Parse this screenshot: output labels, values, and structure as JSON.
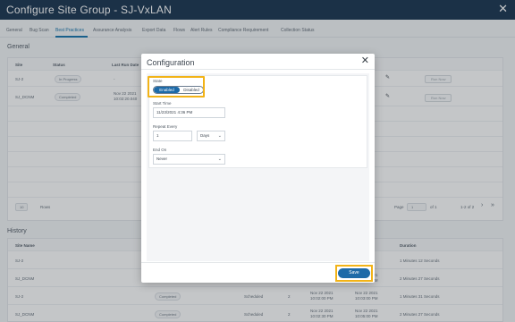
{
  "window": {
    "title": "Configure Site Group - SJ-VxLAN",
    "close_glyph": "✕"
  },
  "tabs": [
    "General",
    "Bug Scan",
    "Best Practices",
    "Assurance Analysis",
    "Export Data",
    "Flows",
    "Alert Rules",
    "Compliance Requirement",
    "Collection Status"
  ],
  "active_tab": "Best Practices",
  "general": {
    "heading": "General",
    "columns": [
      "Site",
      "Status",
      "Last Run Date"
    ],
    "rows": [
      {
        "site": "SJ-2",
        "status": "In Progress",
        "last_run": "-",
        "action": "Run Now"
      },
      {
        "site": "SJ_DCNM",
        "status": "Completed",
        "last_run": "Nov 22 2021 10:02:20.040",
        "action": "Run Now"
      }
    ],
    "pager": {
      "size": "10",
      "rows_label": "Rows",
      "page_label": "Page",
      "page": "1",
      "of": "of 1",
      "range": "1-2 of 2"
    }
  },
  "history": {
    "heading": "History",
    "columns": [
      "Site Name",
      "Duration"
    ],
    "rows": [
      {
        "site": "SJ-2",
        "status": "",
        "type": "",
        "count": "",
        "start": "",
        "end": "",
        "duration": "1 Minutes 12 Seconds"
      },
      {
        "site": "SJ_DCNM",
        "status": "",
        "type": "",
        "count": "",
        "start": "Nov 22 2021 10:02:20 PM",
        "end": "Nov 22 2021 10:21:33 PM",
        "duration": "2 Minutes 27 Seconds"
      },
      {
        "site": "SJ-2",
        "status": "Completed",
        "type": "Scheduled",
        "count": "2",
        "start": "Nov 22 2021 10:02:00 PM",
        "end": "Nov 22 2021 10:03:00 PM",
        "duration": "1 Minutes 31 Seconds"
      },
      {
        "site": "SJ_DCNM",
        "status": "Completed",
        "type": "Scheduled",
        "count": "2",
        "start": "Nov 22 2021 10:02:30 PM",
        "end": "Nov 22 2021 10:05:00 PM",
        "duration": "2 Minutes 27 Seconds"
      }
    ]
  },
  "modal": {
    "title": "Configuration",
    "close_glyph": "✕",
    "state_label": "State",
    "enabled_label": "Enabled",
    "disabled_label": "Disabled",
    "start_time_label": "Start Time",
    "start_time_value": "11/23/2021 4:36 PM",
    "repeat_every_label": "Repeat Every",
    "repeat_value": "1",
    "repeat_unit": "Days",
    "end_on_label": "End On",
    "end_on_value": "Never",
    "save_label": "Save"
  },
  "colors": {
    "header_bg": "#0e2a47",
    "accent": "#1d6aa8",
    "highlight": "#f2b317"
  }
}
